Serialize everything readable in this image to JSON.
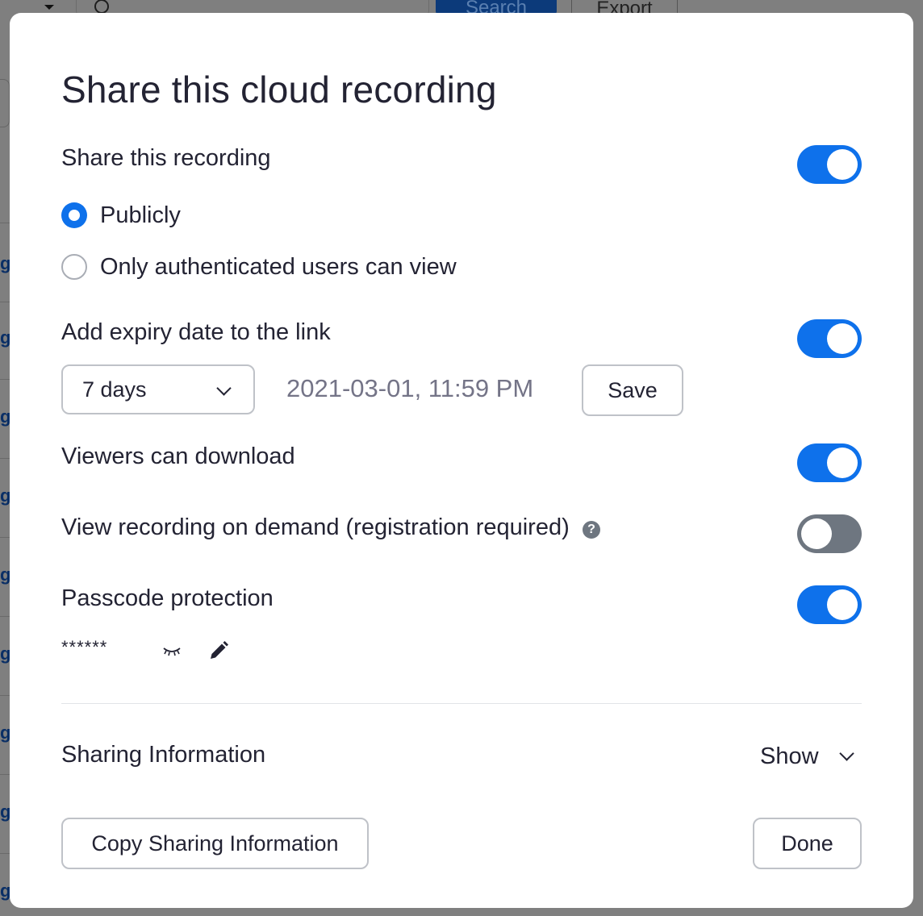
{
  "background": {
    "search_button_label": "Search",
    "export_button_label": "Export",
    "row_link_fragment": "gu"
  },
  "modal": {
    "title": "Share this cloud recording",
    "share_recording": {
      "label": "Share this recording",
      "enabled": true,
      "options": [
        {
          "label": "Publicly",
          "selected": true
        },
        {
          "label": "Only authenticated users can view",
          "selected": false
        }
      ]
    },
    "expiry": {
      "label": "Add expiry date to the link",
      "enabled": true,
      "duration_value": "7 days",
      "expiry_datetime": "2021-03-01, 11:59 PM",
      "save_label": "Save"
    },
    "viewers_download": {
      "label": "Viewers can download",
      "enabled": true
    },
    "on_demand": {
      "label": "View recording on demand (registration required)",
      "enabled": false,
      "help_glyph": "?"
    },
    "passcode": {
      "label": "Passcode protection",
      "enabled": true,
      "masked_value": "******",
      "reveal_icon": "eye-closed-icon",
      "edit_icon": "pencil-icon"
    },
    "sharing_info": {
      "label": "Sharing Information",
      "show_label": "Show"
    },
    "footer": {
      "copy_label": "Copy Sharing Information",
      "done_label": "Done"
    }
  },
  "colors": {
    "accent": "#0e71eb",
    "toggle_off": "#6e7680",
    "text": "#232333",
    "muted_text": "#747487",
    "border": "#bfc2c8"
  }
}
